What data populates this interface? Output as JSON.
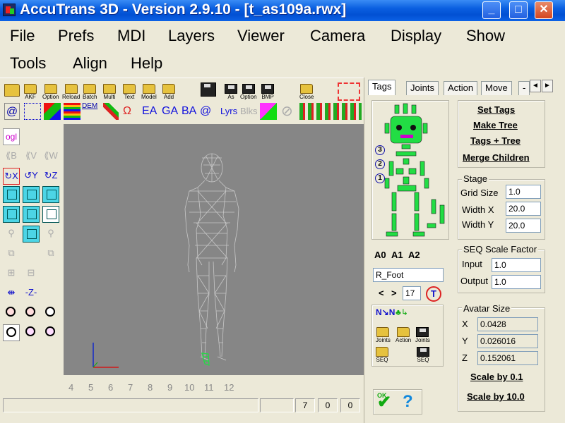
{
  "window": {
    "title": "AccuTrans 3D - Version 2.9.10 - [t_as109a.rwx]",
    "minimize": "_",
    "maximize": "□",
    "close": "✕"
  },
  "menu": {
    "row1": [
      "File",
      "Prefs",
      "MDI",
      "Layers",
      "Viewer",
      "Camera",
      "Display",
      "Show"
    ],
    "row2": [
      "Tools",
      "Align",
      "Help"
    ]
  },
  "toolbar": {
    "row1": [
      "AKF",
      "Option",
      "Reload",
      "Batch",
      "Multi",
      "Text",
      "Model",
      "Add",
      "As",
      "Option",
      "BMP",
      "Close"
    ],
    "row2_text": {
      "ea": "EA",
      "ga": "GA",
      "ba": "BA",
      "at": "@",
      "lyrs": "Lyrs",
      "blks": "Blks",
      "ogl": "ogl"
    }
  },
  "frame_numbers": [
    "4",
    "5",
    "6",
    "7",
    "8",
    "9",
    "10",
    "11",
    "12"
  ],
  "status_bar": {
    "v1": "7",
    "v2": "0",
    "v3": "0"
  },
  "tabs": [
    "Tags",
    "Joints",
    "Action",
    "Move",
    "-"
  ],
  "tab_nav": {
    "left": "◄",
    "right": "►"
  },
  "tags_panel": {
    "buttons": [
      "Set Tags",
      "Make Tree",
      "Tags + Tree",
      "Merge Children"
    ],
    "levels": [
      "3",
      "2",
      "1"
    ],
    "anims": [
      "A0",
      "A1",
      "A2"
    ],
    "name_value": "R_Foot",
    "index_value": "17",
    "nav_left": "<",
    "nav_right": ">",
    "small_icons": [
      "Joints",
      "Action",
      "Joints",
      "SEQ",
      "SEQ"
    ]
  },
  "stage": {
    "title": "Stage",
    "grid_size_label": "Grid Size",
    "grid_size": "1.0",
    "width_x_label": "Width X",
    "width_x": "20.0",
    "width_y_label": "Width Y",
    "width_y": "20.0"
  },
  "seq_scale": {
    "title": "SEQ Scale Factor",
    "input_label": "Input",
    "input": "1.0",
    "output_label": "Output",
    "output": "1.0"
  },
  "avatar_size": {
    "title": "Avatar Size",
    "x_label": "X",
    "x": "0.0428",
    "y_label": "Y",
    "y": "0.026016",
    "z_label": "Z",
    "z": "0.152061",
    "scale_small": "Scale by 0.1",
    "scale_large": "Scale by 10.0"
  },
  "colors": {
    "title_bar": "#0a5fe0",
    "viewport": "#868686",
    "avatar_green": "#22dd44",
    "wireframe": "#c8c8c8"
  }
}
